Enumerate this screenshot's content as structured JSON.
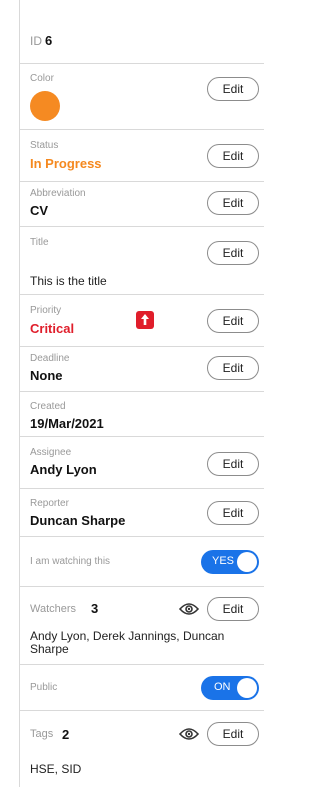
{
  "id": {
    "label": "ID",
    "value": "6"
  },
  "edit_label": "Edit",
  "color": {
    "label": "Color",
    "swatch": "#f58a22"
  },
  "status": {
    "label": "Status",
    "value": "In Progress",
    "color": "#f5891f"
  },
  "abbreviation": {
    "label": "Abbreviation",
    "value": "CV"
  },
  "title": {
    "label": "Title",
    "value": "This is the title"
  },
  "priority": {
    "label": "Priority",
    "value": "Critical",
    "color": "#e01e2b",
    "icon": "arrow-up-icon"
  },
  "deadline": {
    "label": "Deadline",
    "value": "None"
  },
  "created": {
    "label": "Created",
    "value": "19/Mar/2021"
  },
  "assignee": {
    "label": "Assignee",
    "value": "Andy Lyon"
  },
  "reporter": {
    "label": "Reporter",
    "value": "Duncan Sharpe"
  },
  "watching": {
    "label": "I am watching this",
    "toggle_text": "YES",
    "state": true
  },
  "watchers": {
    "label": "Watchers",
    "count": "3",
    "names": "Andy Lyon, Derek Jannings, Duncan Sharpe",
    "icon": "eye-icon"
  },
  "public": {
    "label": "Public",
    "toggle_text": "ON",
    "state": true
  },
  "tags": {
    "label": "Tags",
    "count": "2",
    "names": "HSE, SID",
    "icon": "eye-icon"
  },
  "accent": "#1a73e8"
}
